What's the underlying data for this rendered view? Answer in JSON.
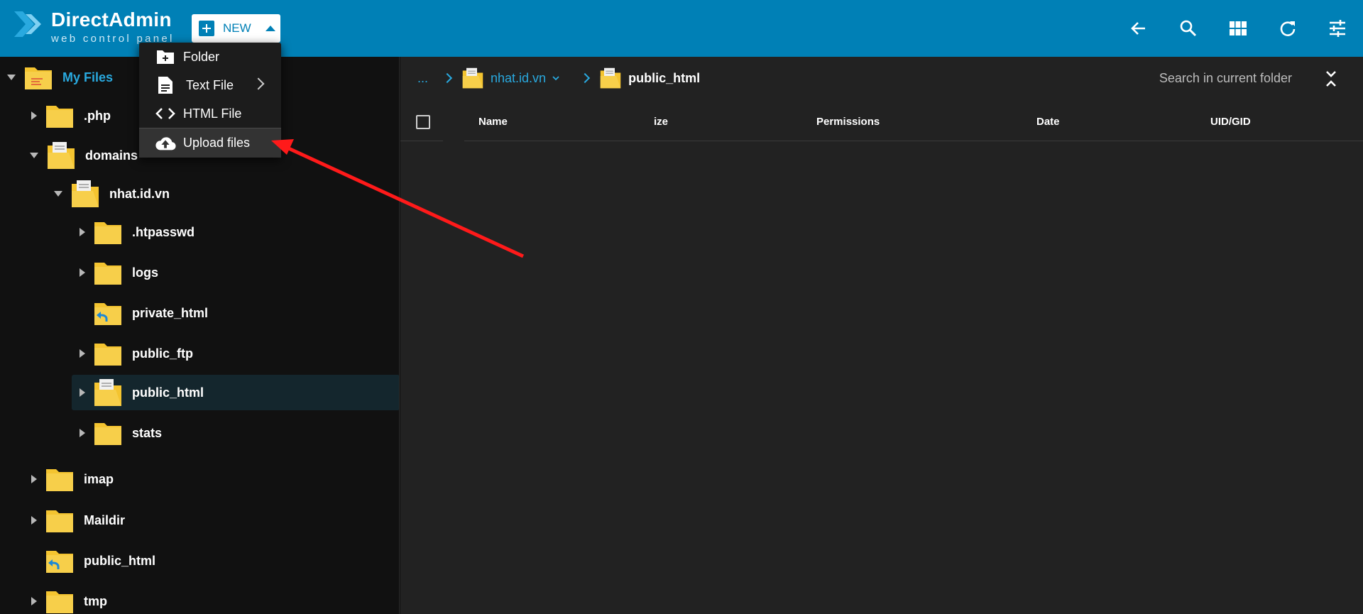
{
  "app": {
    "name": "DirectAdmin",
    "tagline": "web control panel"
  },
  "toolbar": {
    "new_label": "NEW",
    "icons": [
      "back-arrow-icon",
      "search-icon",
      "grid-view-icon",
      "refresh-icon",
      "settings-sliders-icon"
    ]
  },
  "new_menu": {
    "items": [
      {
        "label": "Folder",
        "icon": "new-folder-icon"
      },
      {
        "label": "Text File",
        "icon": "text-file-icon",
        "has_submenu": true
      },
      {
        "label": "HTML File",
        "icon": "code-icon"
      },
      {
        "label": "Upload files",
        "icon": "cloud-upload-icon",
        "highlighted": true
      }
    ]
  },
  "tree": {
    "root": "My Files",
    "items": [
      {
        "label": ".php",
        "expander": "collapsed"
      },
      {
        "label": "domains",
        "expander": "expanded"
      },
      {
        "label": "nhat.id.vn",
        "expander": "expanded"
      },
      {
        "label": ".htpasswd",
        "expander": "collapsed"
      },
      {
        "label": "logs",
        "expander": "collapsed"
      },
      {
        "label": "private_html",
        "expander": "none",
        "symlink": true
      },
      {
        "label": "public_ftp",
        "expander": "collapsed"
      },
      {
        "label": "public_html",
        "expander": "collapsed",
        "selected": true
      },
      {
        "label": "stats",
        "expander": "collapsed"
      },
      {
        "label": "imap",
        "expander": "collapsed"
      },
      {
        "label": "Maildir",
        "expander": "collapsed"
      },
      {
        "label": "public_html",
        "expander": "none",
        "symlink": true
      },
      {
        "label": "tmp",
        "expander": "collapsed"
      }
    ]
  },
  "breadcrumb": {
    "ellipsis": "...",
    "domain": "nhat.id.vn",
    "current": "public_html"
  },
  "search": {
    "label": "Search in current folder"
  },
  "table": {
    "columns": [
      "Name",
      "ize",
      "Permissions",
      "Date",
      "UID/GID"
    ]
  },
  "colors": {
    "topbar": "#0080b6",
    "accent": "#29a9df",
    "folder": "#f4c430",
    "annotation": "#ff1a1a"
  }
}
